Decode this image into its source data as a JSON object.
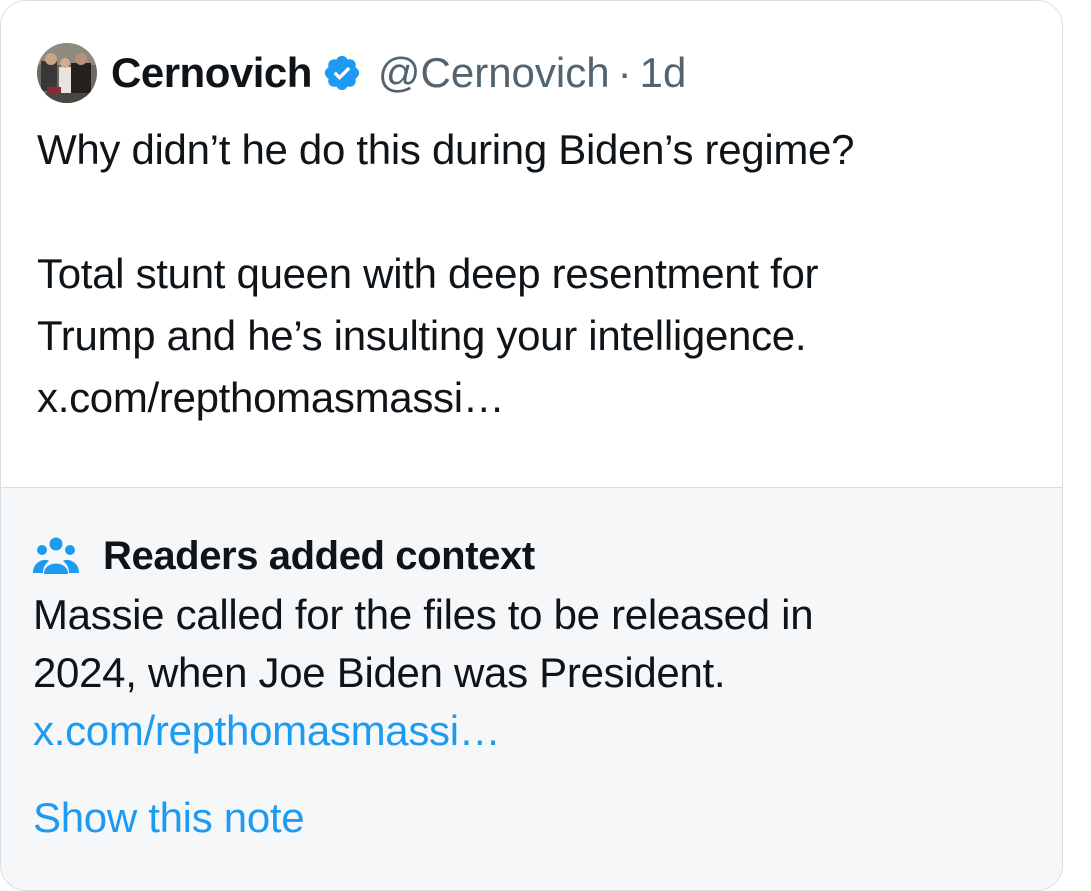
{
  "tweet": {
    "display_name": "Cernovich",
    "handle": "@Cernovich",
    "separator": "·",
    "time": "1d",
    "avatar_icon": "avatar-photo",
    "verified_icon": "verified-badge-icon",
    "verified_color": "#1d9bf0",
    "lines": [
      "Why didn’t he do this during Biden’s regime?",
      "Total stunt queen with deep resentment for",
      "Trump and he’s insulting your intelligence.",
      "x.com/repthomasmassi…"
    ]
  },
  "community_note": {
    "icon": "people-icon",
    "title": "Readers added context",
    "lines": [
      "Massie called for the files to be released in",
      "2024, when Joe Biden was President."
    ],
    "link": "x.com/repthomasmassi…",
    "show_note_label": "Show this note",
    "link_color": "#1d9bf0",
    "background": "#f6f7f9"
  }
}
